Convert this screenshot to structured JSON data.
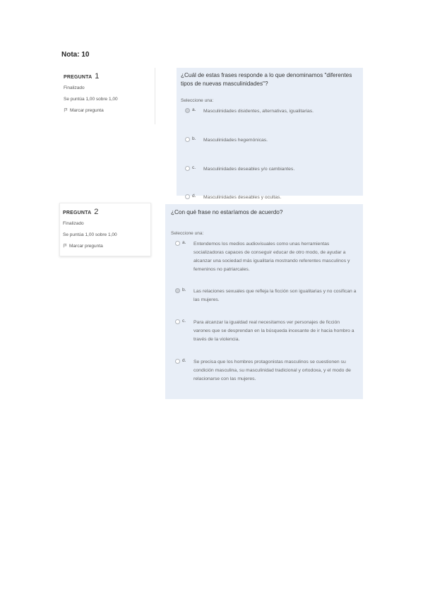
{
  "grade": "Nota: 10",
  "questions": [
    {
      "label": "PREGUNTA",
      "number": "1",
      "status": "Finalizado",
      "score": "Se puntúa 1,00 sobre 1,00",
      "flag_label": "Marcar pregunta",
      "text": "¿Cuál de estas frases responde a lo que denominamos \"diferentes tipos de nuevas masculinidades\"?",
      "select_prompt": "Seleccione una:",
      "options": [
        {
          "letter": "a.",
          "text": "Masculinidades disidentes, alternativas, igualitarias.",
          "checked": true
        },
        {
          "letter": "b.",
          "text": "Masculinidades hegemónicas.",
          "checked": false
        },
        {
          "letter": "c.",
          "text": "Masculinidades deseables y/o cambiantes.",
          "checked": false
        },
        {
          "letter": "d.",
          "text": "Masculinidades deseables y ocultas.",
          "checked": false
        }
      ]
    },
    {
      "label": "PREGUNTA",
      "number": "2",
      "status": "Finalizado",
      "score": "Se puntúa 1,00 sobre 1,00",
      "flag_label": "Marcar pregunta",
      "text": "¿Con qué frase no estaríamos de acuerdo?",
      "select_prompt": "Seleccione una:",
      "options": [
        {
          "letter": "a.",
          "text": "Entendemos los medios audiovisuales como unas herramientas socializadoras capaces de conseguir educar de otro modo, de ayudar a alcanzar una sociedad más igualitaria mostrando referentes masculinos y femeninos no patriarcales.",
          "checked": false
        },
        {
          "letter": "b.",
          "text": "Las relaciones sexuales que refleja la ficción son igualitarias y no cosifican a las mujeres.",
          "checked": true
        },
        {
          "letter": "c.",
          "text": "Para alcanzar la igualdad real necesitamos ver personajes de ficción varones que se desprendan en la búsqueda incesante de ir hacia hombro a través de la violencia.",
          "checked": false
        },
        {
          "letter": "d.",
          "text": "Se precisa que los hombres protagonistas masculinos se cuestionen su condición masculina, su masculinidad tradicional y ortodoxa, y el modo de relacionarse con las mujeres.",
          "checked": false
        }
      ]
    }
  ]
}
